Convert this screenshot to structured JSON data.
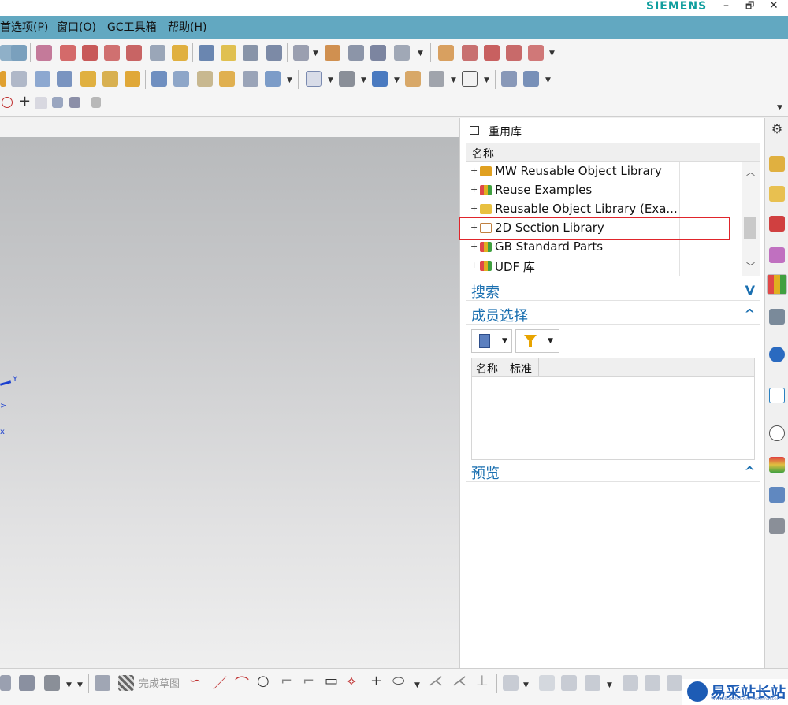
{
  "window": {
    "brand": "SIEMENS",
    "minimize": "–",
    "restore": "🗗",
    "close": "✕"
  },
  "menu": {
    "items": [
      "首选项(P)",
      "窗口(O)",
      "GC工具箱",
      "帮助(H)"
    ]
  },
  "graphics": {
    "axis_y": "Y",
    "axis_z": ">",
    "axis_x": "x"
  },
  "reuse_library": {
    "title": "重用库",
    "column_name": "名称",
    "items": [
      {
        "label": "MW Reusable Object Library",
        "icon": "library-stack-icon"
      },
      {
        "label": "Reuse Examples",
        "icon": "library-books-icon"
      },
      {
        "label": "Reusable Object Library (Exa...",
        "icon": "library-edit-icon"
      },
      {
        "label": "2D Section Library",
        "icon": "section-library-icon"
      },
      {
        "label": "GB Standard Parts",
        "icon": "library-books-icon"
      },
      {
        "label": "UDF 库",
        "icon": "library-books-icon"
      }
    ],
    "highlighted_item": "2D Section Library"
  },
  "search": {
    "title": "搜索",
    "state": "collapsed"
  },
  "member_select": {
    "title": "成员选择",
    "state": "expanded",
    "columns": [
      "名称",
      "标准"
    ]
  },
  "preview": {
    "title": "预览",
    "state": "expanded"
  },
  "bottom_toolbar": {
    "finish_sketch": "完成草图"
  },
  "watermark": {
    "text": "易采站长站",
    "sub": "Www.Easck.Com  Webmaster"
  },
  "colors": {
    "menubar": "#62a8c1",
    "brand": "#0f9e9e",
    "section_title": "#1a6fb0",
    "highlight": "#e0252b"
  }
}
